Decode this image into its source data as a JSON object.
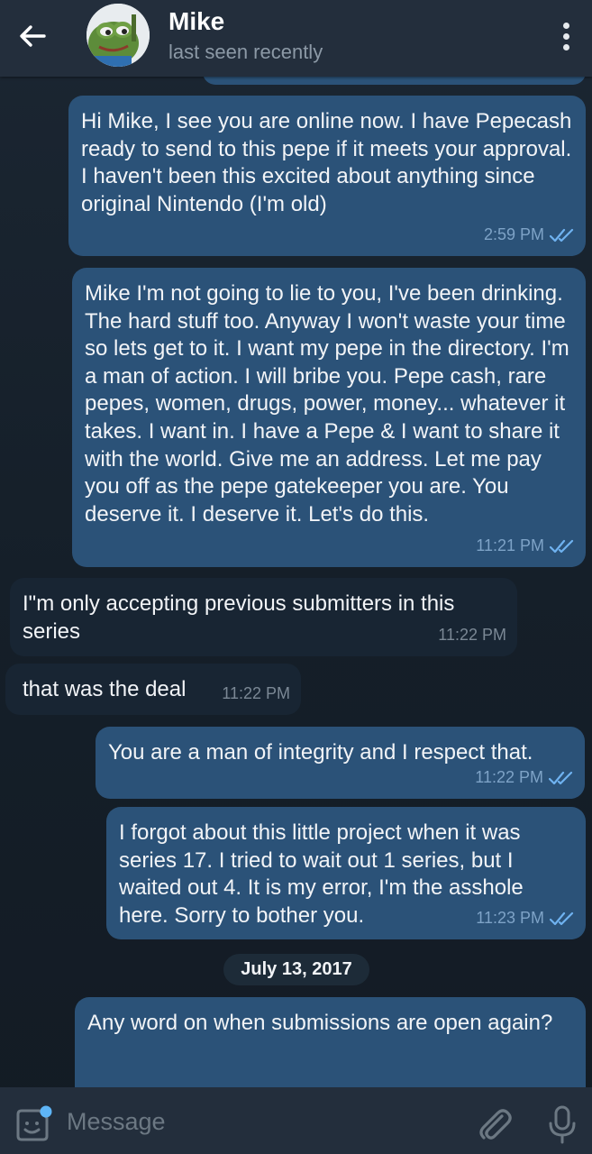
{
  "header": {
    "back_icon": "arrow-left-icon",
    "contact_name": "Mike",
    "status": "last seen recently",
    "menu_icon": "more-vertical-icon"
  },
  "messages": [
    {
      "direction": "outgoing",
      "text": "Hi Mike, I see you are online now.  I have Pepecash ready to send to this pepe if it meets your approval.  I haven't been this excited about anything since original Nintendo (I'm old)",
      "time": "2:59 PM",
      "status_icon": "double-check-icon"
    },
    {
      "direction": "outgoing",
      "text": "Mike I'm not going to lie to you, I've been drinking. The hard stuff too. Anyway I won't waste your time so lets get to it. I want my pepe in the directory. I'm a man of action. I will bribe you. Pepe cash, rare pepes, women, drugs, power, money... whatever it takes. I want in. I have a Pepe & I want to share it with the world.  Give me an address. Let me pay you off as the pepe gatekeeper you are. You deserve it. I deserve it. Let's do this.",
      "time": "11:21 PM",
      "status_icon": "double-check-icon"
    },
    {
      "direction": "incoming",
      "text": "I\"m only accepting previous submitters in this series",
      "time": "11:22 PM"
    },
    {
      "direction": "incoming",
      "text": "that was the deal",
      "time": "11:22 PM"
    },
    {
      "direction": "outgoing",
      "text": "You are a man of integrity and I respect that.",
      "time": "11:22 PM",
      "status_icon": "double-check-icon"
    },
    {
      "direction": "outgoing",
      "text": "I forgot about this little project when it was series 17.  I tried to wait out 1 series, but I waited out 4. It is my error, I'm the asshole here.  Sorry to bother you.",
      "time": "11:23 PM",
      "status_icon": "double-check-icon"
    },
    {
      "direction": "outgoing",
      "text": "Any word on when submissions are open again?",
      "time": ""
    }
  ],
  "date_separator": "July 13, 2017",
  "composer": {
    "placeholder": "Message",
    "sticker_icon": "sticker-icon",
    "attach_icon": "paperclip-icon",
    "mic_icon": "microphone-icon"
  },
  "colors": {
    "header_bg": "#232e3c",
    "chat_bg": "#17212b",
    "outgoing_bubble": "#2b5278",
    "incoming_bubble": "#182533",
    "accent": "#5eb5f7"
  }
}
